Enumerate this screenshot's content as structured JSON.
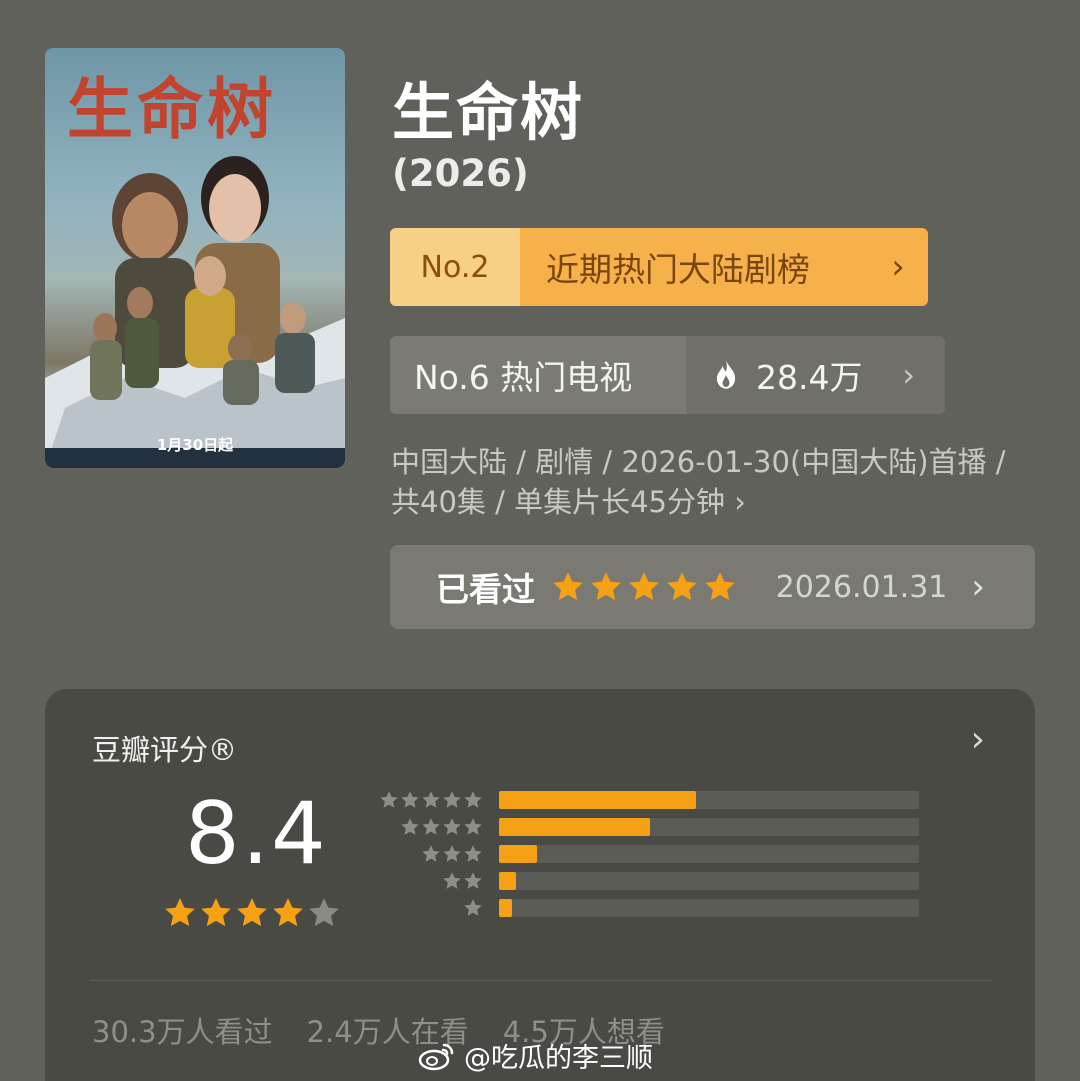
{
  "poster": {
    "title_art": "生命树",
    "date_text": "1月30日起"
  },
  "show": {
    "title": "生命树",
    "year": "(2026)"
  },
  "rank_primary": {
    "number": "No.2",
    "label": "近期热门大陆剧榜",
    "chevron": "›"
  },
  "rank_secondary": {
    "label": "No.6 热门电视",
    "heat": "28.4万",
    "chevron": "›"
  },
  "info": {
    "text": "中国大陆 / 剧情 / 2026-01-30(中国大陆)首播 / 共40集 / 单集片长45分钟",
    "chevron": "›"
  },
  "watched": {
    "label": "已看过",
    "my_stars": 5,
    "date": "2026.01.31",
    "chevron": "›"
  },
  "rating": {
    "label": "豆瓣评分®",
    "score": "8.4",
    "score_stars": 4,
    "chevron": "›",
    "distribution": [
      {
        "stars": 5,
        "fraction": 0.47
      },
      {
        "stars": 4,
        "fraction": 0.36
      },
      {
        "stars": 3,
        "fraction": 0.09
      },
      {
        "stars": 2,
        "fraction": 0.04
      },
      {
        "stars": 1,
        "fraction": 0.03
      }
    ],
    "stats": {
      "watched": "30.3万人看过",
      "watching": "2.4万人在看",
      "want": "4.5万人想看"
    }
  },
  "watermark": {
    "text": "@吃瓜的李三顺"
  },
  "colors": {
    "background": "#61615b",
    "accent_orange": "#f5a115",
    "rank_badge": "#f6b14a",
    "card": "#4a4a45"
  },
  "icons": [
    "fire-icon",
    "star-icon",
    "chevron-right-icon",
    "weibo-icon"
  ]
}
